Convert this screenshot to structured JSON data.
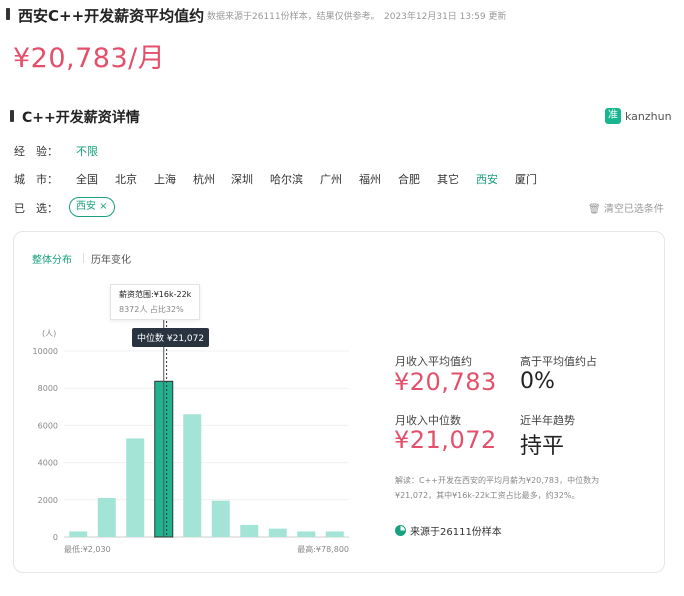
{
  "header": {
    "title": "西安C++开发薪资平均值约",
    "meta": "数据来源于26111份样本，结果仅供参考。",
    "date": "2023年12月31日 13:59 更新",
    "salary": "¥20,783/月"
  },
  "section": {
    "title": "C++开发薪资详情",
    "logo_text": "kanzhun",
    "logo_glyph": "准"
  },
  "filters": {
    "experience_label": "经　验：",
    "experience_value": "不限",
    "city_label": "城　市：",
    "cities": [
      "全国",
      "北京",
      "上海",
      "杭州",
      "深圳",
      "哈尔滨",
      "广州",
      "福州",
      "合肥",
      "其它",
      "西安",
      "厦门"
    ],
    "active_city": "西安",
    "selected_label": "已　选：",
    "chip": "西安 ×",
    "clear": "清空已选条件"
  },
  "tabs": [
    "整体分布",
    "历年变化"
  ],
  "chart_data": {
    "type": "bar",
    "ylabel": "(人)",
    "yticks": [
      0,
      2000,
      4000,
      6000,
      8000,
      10000
    ],
    "ylim": [
      0,
      10000
    ],
    "values": [
      300,
      2100,
      5300,
      8372,
      6600,
      1950,
      650,
      450,
      300,
      300
    ],
    "highlight_index": 3,
    "x_min_label": "最低:¥2,030",
    "x_max_label": "最高:¥78,800",
    "median_index": 3.6,
    "colors": {
      "normal": "#a3e4d6",
      "highlight": "#1fb48f",
      "highlight_border": "#333333"
    },
    "tooltip": {
      "title": "薪资范围:¥16k-22k",
      "sub": "8372人  占比32%"
    },
    "median_tag": "中位数 ¥21,072"
  },
  "stats": {
    "avg_label": "月收入平均值约",
    "avg_value": "¥20,783",
    "above_label": "高于平均值约占",
    "above_value": "0%",
    "median_label": "月收入中位数",
    "median_value": "¥21,072",
    "trend_label": "近半年趋势",
    "trend_value": "持平",
    "desc_line1": "解读：C++开发在西安的平均月薪为¥20,783，中位数为",
    "desc_line2": "¥21,072，其中¥16k-22k工资占比最多，约32%。",
    "source": "来源于26111份样本"
  }
}
